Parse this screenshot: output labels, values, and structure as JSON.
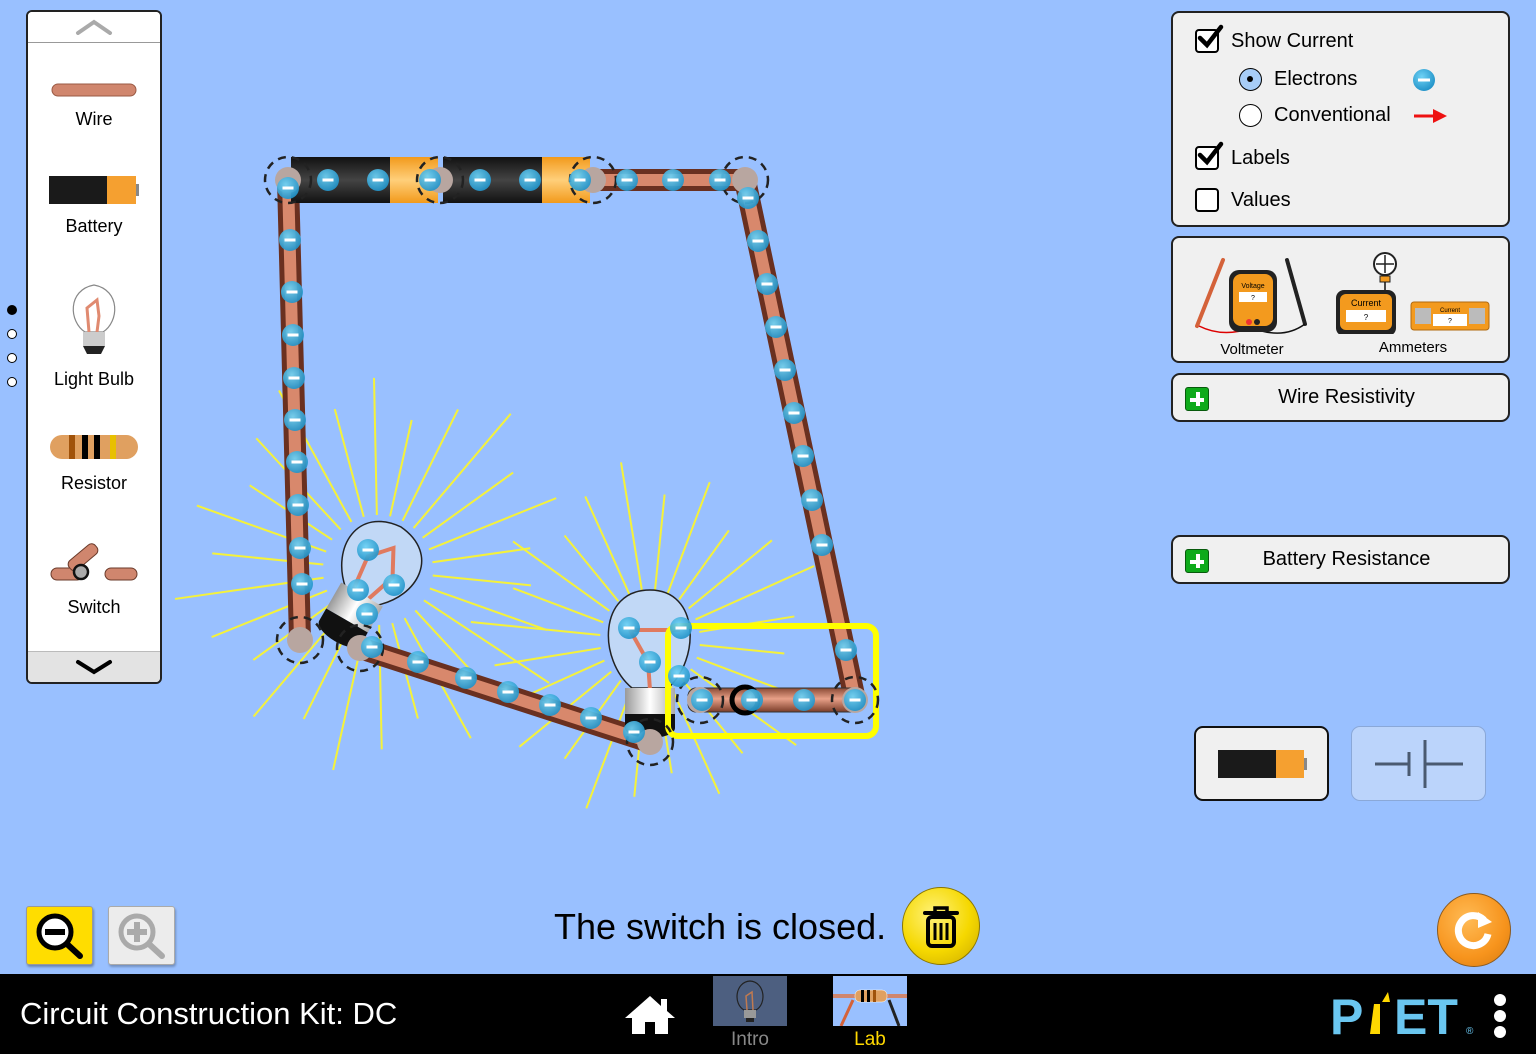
{
  "app": {
    "title": "Circuit Construction Kit: DC"
  },
  "carousel": {
    "items": [
      {
        "label": "Wire",
        "icon": "wire-icon"
      },
      {
        "label": "Battery",
        "icon": "battery-icon"
      },
      {
        "label": "Light Bulb",
        "icon": "light-bulb-icon"
      },
      {
        "label": "Resistor",
        "icon": "resistor-icon"
      },
      {
        "label": "Switch",
        "icon": "switch-icon"
      }
    ],
    "page_count": 4,
    "current_page": 1
  },
  "display_panel": {
    "show_current": {
      "label": "Show Current",
      "checked": true
    },
    "current_type": [
      {
        "label": "Electrons",
        "selected": true,
        "icon": "electron-icon"
      },
      {
        "label": "Conventional",
        "selected": false,
        "icon": "red-arrow-icon"
      }
    ],
    "labels": {
      "label": "Labels",
      "checked": true
    },
    "values": {
      "label": "Values",
      "checked": false
    }
  },
  "meters_panel": {
    "voltmeter": {
      "label": "Voltmeter",
      "screen_title": "Voltage",
      "screen_value": "?"
    },
    "ammeters": {
      "label": "Ammeters",
      "probe_screen_title": "Current",
      "probe_screen_value": "?",
      "series_screen_title": "Current",
      "series_screen_value": "?"
    }
  },
  "accordions": {
    "wire_resistivity": {
      "label": "Wire Resistivity",
      "expanded": false
    },
    "battery_resistance": {
      "label": "Battery Resistance",
      "expanded": false
    }
  },
  "view_mode": {
    "options": [
      "lifelike",
      "schematic"
    ],
    "selected": "lifelike"
  },
  "status": {
    "message": "The switch is closed."
  },
  "zoom": {
    "zoom_out_enabled": true,
    "zoom_in_enabled": false
  },
  "navbar": {
    "screens": [
      {
        "label": "Intro",
        "active": false
      },
      {
        "label": "Lab",
        "active": true
      }
    ],
    "brand": "PhET"
  },
  "circuit": {
    "components": [
      {
        "type": "battery",
        "count": 2
      },
      {
        "type": "light-bulb",
        "count": 2,
        "lit": true
      },
      {
        "type": "switch",
        "state": "closed",
        "selected": true
      },
      {
        "type": "wire",
        "count": 4
      }
    ],
    "current_display": "electrons"
  },
  "colors": {
    "background": "#99c0ff",
    "selection": "#ffff00",
    "electron": "#2aa6dc",
    "wire": "#c8745a",
    "lab_tab": "#ffd800"
  }
}
